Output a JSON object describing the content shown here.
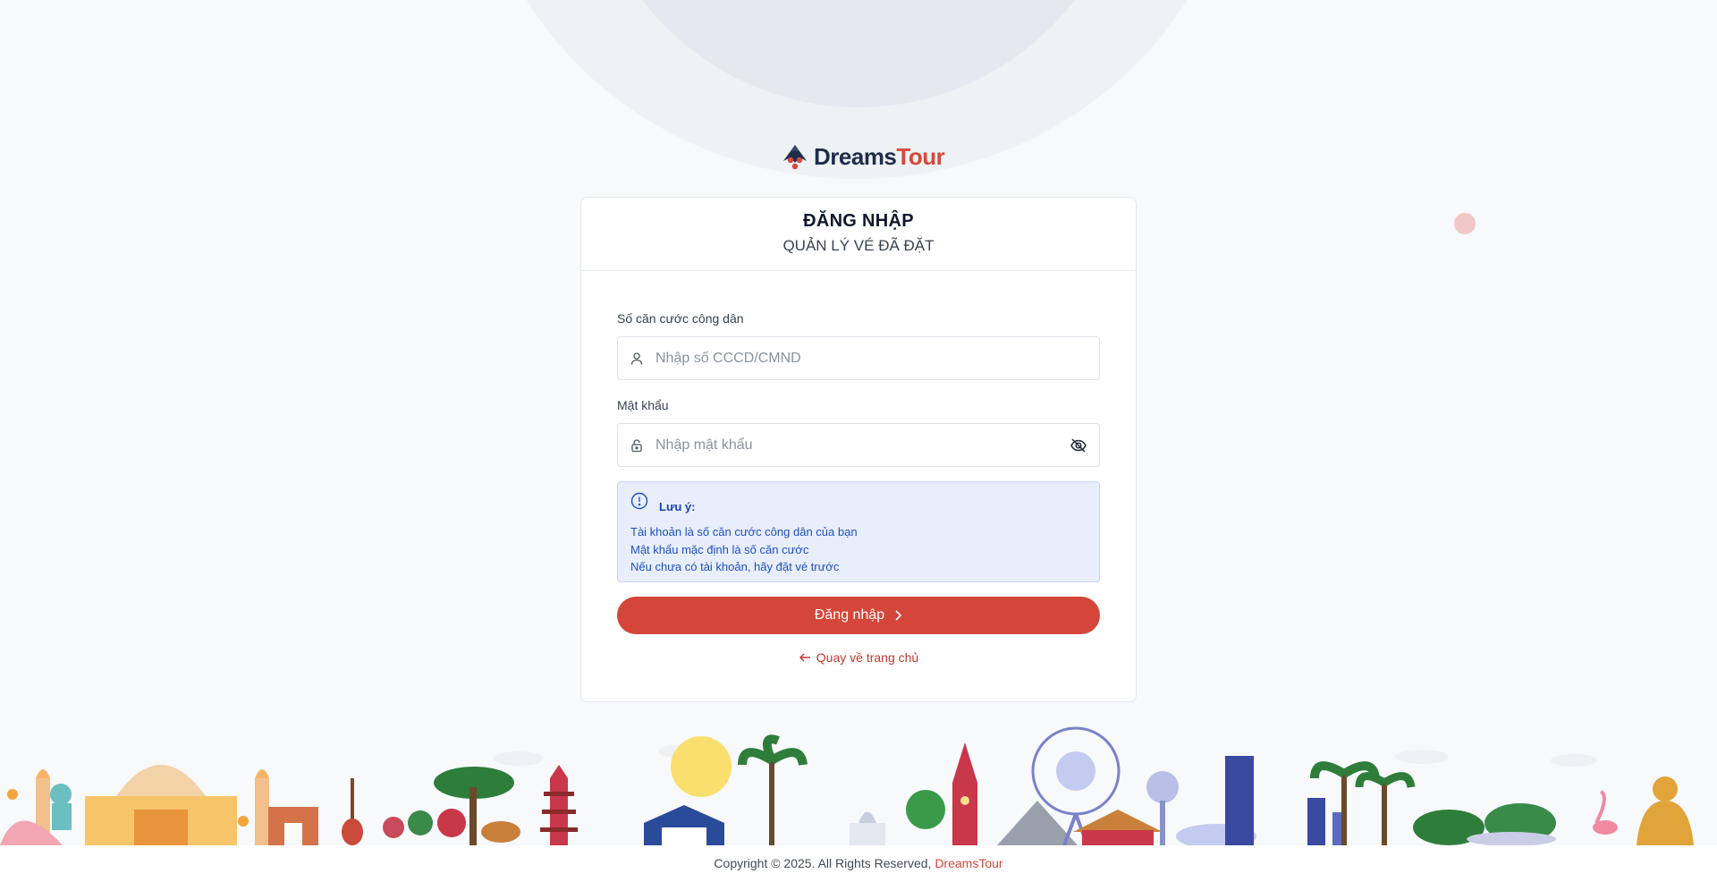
{
  "brand": {
    "name_part1": "Dreams",
    "name_part2": "Tour",
    "primary_color": "#d5463a",
    "navy_color": "#1f2d4a"
  },
  "card": {
    "title": "ĐĂNG NHẬP",
    "subtitle": "QUẢN LÝ VÉ ĐÃ ĐẶT"
  },
  "form": {
    "cccd": {
      "label": "Số căn cước công dân",
      "placeholder": "Nhập số CCCD/CMND",
      "value": "",
      "icon": "user-icon"
    },
    "password": {
      "label": "Mật khẩu",
      "placeholder": "Nhập mật khẩu",
      "value": "",
      "icon": "lock-icon",
      "toggle_icon": "eye-off-icon"
    }
  },
  "note": {
    "icon": "info-circle-icon",
    "title": "Lưu ý:",
    "lines": [
      "Tài khoản là số căn cước công dân của bạn",
      "Mật khẩu mặc định là số căn cước",
      "Nếu chưa có tài khoản, hãy đặt vé trước"
    ]
  },
  "actions": {
    "login_label": "Đăng nhập",
    "back_label": "Quay về trang chủ"
  },
  "footer": {
    "copyright": "Copyright © 2025. All Rights Reserved,",
    "brand": "DreamsTour"
  }
}
